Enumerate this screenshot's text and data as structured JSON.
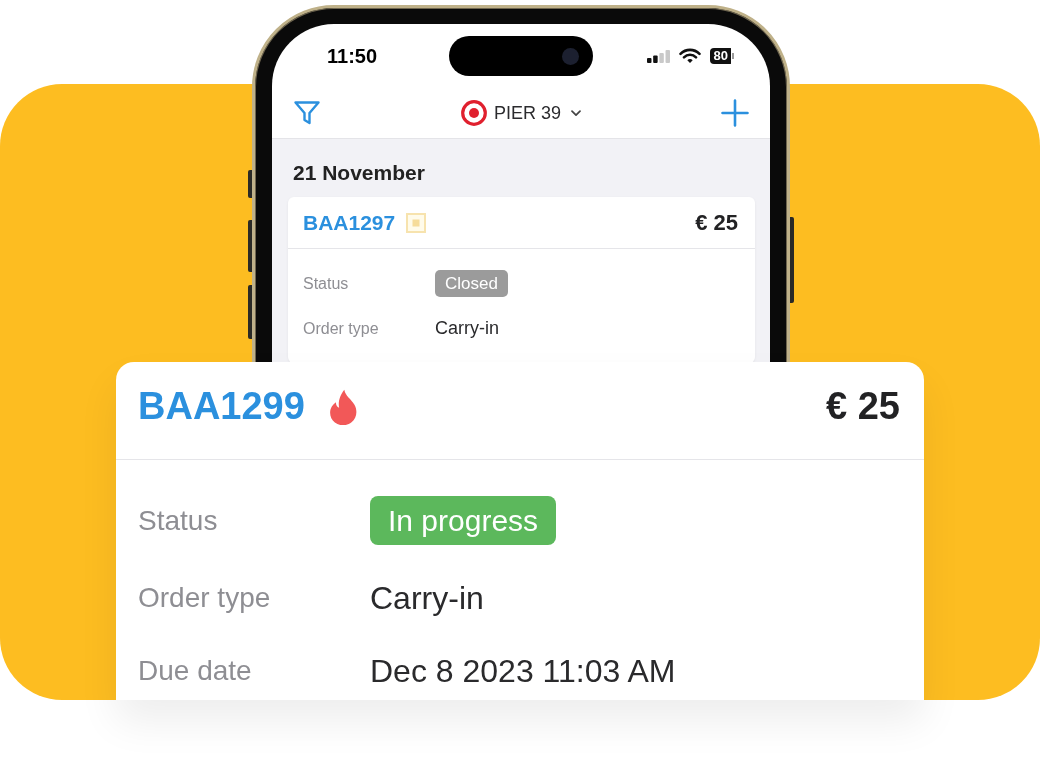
{
  "phone": {
    "status_bar": {
      "time": "11:50",
      "battery": "80"
    },
    "nav_bar": {
      "location": "PIER 39"
    },
    "list": {
      "date_heading": "21 November",
      "orders": [
        {
          "number": "BAA1297",
          "price": "€ 25",
          "fields": [
            {
              "label": "Status",
              "value": "Closed",
              "kind": "badge",
              "color": "#9b9b9b"
            },
            {
              "label": "Order type",
              "value": "Carry-in",
              "kind": "text"
            }
          ]
        }
      ]
    }
  },
  "featured_order": {
    "number": "BAA1299",
    "price": "€ 25",
    "fields": [
      {
        "label": "Status",
        "value": "In progress",
        "kind": "badge",
        "color": "#5cb85c"
      },
      {
        "label": "Order type",
        "value": "Carry-in",
        "kind": "text"
      },
      {
        "label": "Due date",
        "value": "Dec 8 2023 11:03 AM",
        "kind": "text"
      }
    ]
  }
}
